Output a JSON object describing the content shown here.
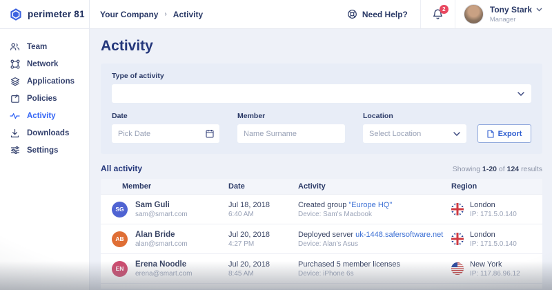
{
  "colors": {
    "accent_blue": "#3566f5",
    "navy_text": "#2b3a67",
    "link_blue": "#3b6fd4",
    "badge_red": "#e8475f",
    "panel_bg": "#e8edf7",
    "page_bg": "#eef1f8"
  },
  "icons": [
    "logo-hexagon-icon",
    "lifebuoy-icon",
    "bell-icon",
    "chevron-down-icon",
    "team-icon",
    "network-icon",
    "applications-icon",
    "policies-icon",
    "activity-icon",
    "downloads-icon",
    "settings-icon",
    "calendar-icon",
    "export-file-icon",
    "uk-flag-icon",
    "us-flag-icon"
  ],
  "brand": {
    "name": "perimeter 81"
  },
  "header": {
    "breadcrumb": {
      "company": "Your Company",
      "page": "Activity"
    },
    "need_help": "Need Help?",
    "notifications_count": "2",
    "user": {
      "name": "Tony Stark",
      "role": "Manager"
    }
  },
  "sidebar": {
    "items": [
      {
        "label": "Team",
        "icon": "team-icon"
      },
      {
        "label": "Network",
        "icon": "network-icon"
      },
      {
        "label": "Applications",
        "icon": "applications-icon"
      },
      {
        "label": "Policies",
        "icon": "policies-icon"
      },
      {
        "label": "Activity",
        "icon": "activity-icon",
        "active": true
      },
      {
        "label": "Downloads",
        "icon": "downloads-icon"
      },
      {
        "label": "Settings",
        "icon": "settings-icon"
      }
    ]
  },
  "page": {
    "title": "Activity"
  },
  "filters": {
    "type_label": "Type of activity",
    "date_label": "Date",
    "date_placeholder": "Pick Date",
    "member_label": "Member",
    "member_placeholder": "Name Surname",
    "location_label": "Location",
    "location_placeholder": "Select Location",
    "export_label": "Export"
  },
  "activity": {
    "section_title": "All activity",
    "showing": {
      "prefix": "Showing",
      "range": "1-20",
      "of": "of",
      "total": "124",
      "suffix": "results"
    },
    "columns": {
      "member": "Member",
      "date": "Date",
      "activity": "Activity",
      "region": "Region"
    },
    "rows": [
      {
        "initials": "SG",
        "avatar_color": "#4f63d2",
        "name": "Sam Guli",
        "email": "sam@smart.com",
        "date": "Jul 18, 2018",
        "time": "6:40 AM",
        "activity_text": "Created group ",
        "activity_link": "\"Europe HQ\"",
        "device": "Device: Sam's Macbook",
        "flag": "uk",
        "region": "London",
        "ip": "IP: 171.5.0.140"
      },
      {
        "initials": "AB",
        "avatar_color": "#df6e35",
        "name": "Alan Bride",
        "email": "alan@smart.com",
        "date": "Jul 20, 2018",
        "time": "4:27 PM",
        "activity_text": "Deployed server ",
        "activity_link": "uk-1448.safersoftware.net",
        "device": "Device: Alan's Asus",
        "flag": "uk",
        "region": "London",
        "ip": "IP: 171.5.0.140"
      },
      {
        "initials": "EN",
        "avatar_color": "#cf4a6e",
        "name": "Erena Noodle",
        "email": "erena@smart.com",
        "date": "Jul 20, 2018",
        "time": "8:45 AM",
        "activity_text": "Purchased 5 member licenses",
        "activity_link": "",
        "device": "Device: iPhone 6s",
        "flag": "us",
        "region": "New York",
        "ip": "IP: 117.86.96.12"
      }
    ]
  }
}
